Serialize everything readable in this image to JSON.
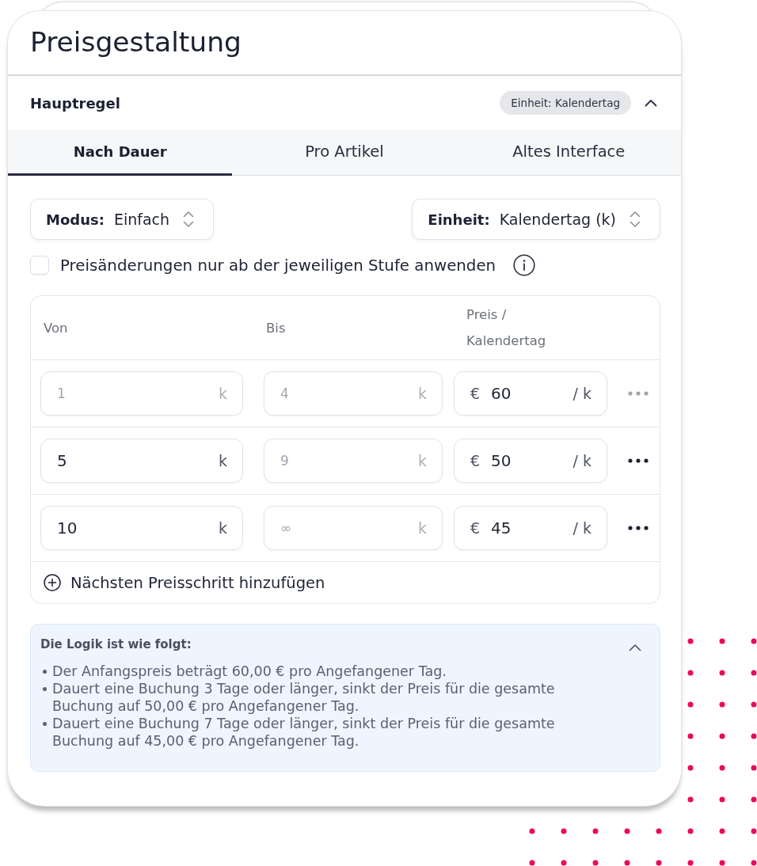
{
  "title": "Preisgestaltung",
  "rule": {
    "name": "Hauptregel",
    "badge": "Einheit: Kalendertag",
    "expanded": true
  },
  "tabs": [
    {
      "label": "Nach Dauer",
      "selected": true
    },
    {
      "label": "Pro Artikel",
      "selected": false
    },
    {
      "label": "Altes Interface",
      "selected": false
    }
  ],
  "selects": [
    {
      "label": "Modus:",
      "value": "Einfach"
    },
    {
      "label": "Einheit:",
      "value": "Kalendertag (k)"
    }
  ],
  "checkbox": {
    "label": "Preisänderungen nur ab der jeweiligen Stufe anwenden",
    "checked": false
  },
  "table": {
    "columns": [
      "Von",
      "Bis",
      "Preis / Kalendertag"
    ],
    "rows": [
      {
        "from": {
          "value": "1",
          "unit": "k",
          "disabled": true
        },
        "to": {
          "value": "4",
          "unit": "k",
          "disabled": true
        },
        "price": {
          "currency": "€",
          "value": "60",
          "unit": "/ k"
        },
        "menu_disabled": true
      },
      {
        "from": {
          "value": "5",
          "unit": "k",
          "disabled": false
        },
        "to": {
          "value": "9",
          "unit": "k",
          "disabled": true
        },
        "price": {
          "currency": "€",
          "value": "50",
          "unit": "/ k"
        },
        "menu_disabled": false
      },
      {
        "from": {
          "value": "10",
          "unit": "k",
          "disabled": false
        },
        "to": {
          "value": "∞",
          "unit": "k",
          "disabled": true
        },
        "price": {
          "currency": "€",
          "value": "45",
          "unit": "/ k"
        },
        "menu_disabled": false
      }
    ],
    "add_label": "Nächsten Preisschritt hinzufügen"
  },
  "logic": {
    "title": "Die Logik ist wie folgt:",
    "expanded": true,
    "items": [
      "Der Anfangspreis beträgt 60,00 € pro Angefangener Tag.",
      "Dauert eine Buchung 3 Tage oder länger, sinkt der Preis für die gesamte Buchung auf 50,00 € pro Angefangener Tag.",
      "Dauert eine Buchung 7 Tage oder länger, sinkt der Preis für die gesamte Buchung auf 45,00 € pro Angefangener Tag."
    ]
  }
}
